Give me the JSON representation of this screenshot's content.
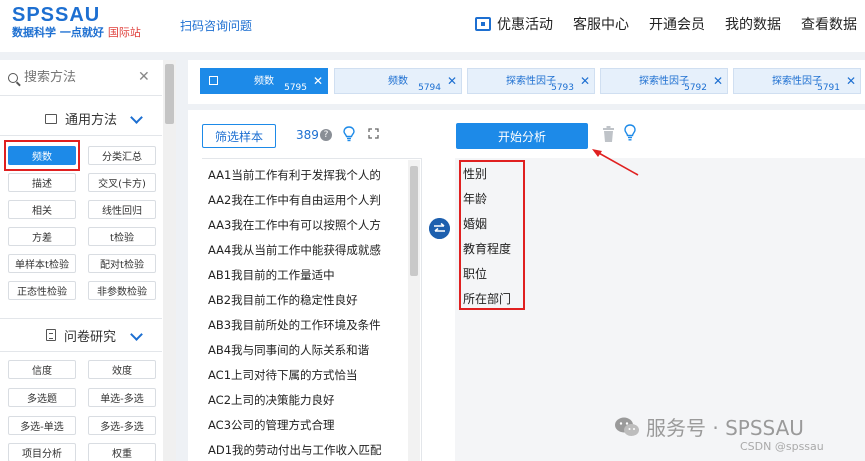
{
  "header": {
    "logo_main": "SPSSAU",
    "logo_sub": "数据科学 一点就好",
    "logo_intl": "国际站",
    "scan_link": "扫码咨询问题",
    "nav": [
      "优惠活动",
      "客服中心",
      "开通会员",
      "我的数据",
      "查看数据"
    ]
  },
  "sidebar": {
    "search_placeholder": "搜索方法",
    "sections": [
      {
        "title": "通用方法",
        "items": [
          "频数",
          "分类汇总",
          "描述",
          "交叉(卡方)",
          "相关",
          "线性回归",
          "方差",
          "t检验",
          "单样本t检验",
          "配对t检验",
          "正态性检验",
          "非参数检验"
        ]
      },
      {
        "title": "问卷研究",
        "items": [
          "信度",
          "效度",
          "多选题",
          "单选-多选",
          "多选-单选",
          "多选-多选",
          "项目分析",
          "权重"
        ]
      }
    ],
    "active_item": "频数"
  },
  "tabs": [
    {
      "label": "频数",
      "num": "5795",
      "active": true
    },
    {
      "label": "频数",
      "num": "5794",
      "active": false
    },
    {
      "label": "探索性因子",
      "num": "5793",
      "active": false
    },
    {
      "label": "探索性因子",
      "num": "5792",
      "active": false
    },
    {
      "label": "探索性因子",
      "num": "5791",
      "active": false
    }
  ],
  "toolbar": {
    "filter_label": "筛选样本",
    "count": "389",
    "start_label": "开始分析"
  },
  "variables": [
    "AA1当前工作有利于发挥我个人的",
    "AA2我在工作中有自由运用个人判",
    "AA3我在工作中有可以按照个人方",
    "AA4我从当前工作中能获得成就感",
    "AB1我目前的工作量适中",
    "AB2我目前工作的稳定性良好",
    "AB3我目前所处的工作环境及条件",
    "AB4我与同事间的人际关系和谐",
    "AC1上司对待下属的方式恰当",
    "AC2上司的决策能力良好",
    "AC3公司的管理方式合理",
    "AD1我的劳动付出与工作收入匹配"
  ],
  "selected_vars": [
    "性别",
    "年龄",
    "婚姻",
    "教育程度",
    "职位",
    "所在部门"
  ],
  "watermark": {
    "text": "服务号 · SPSSAU",
    "csdn": "CSDN @spssau"
  },
  "colors": {
    "accent": "#1d8ae8",
    "highlight": "#e02020"
  }
}
